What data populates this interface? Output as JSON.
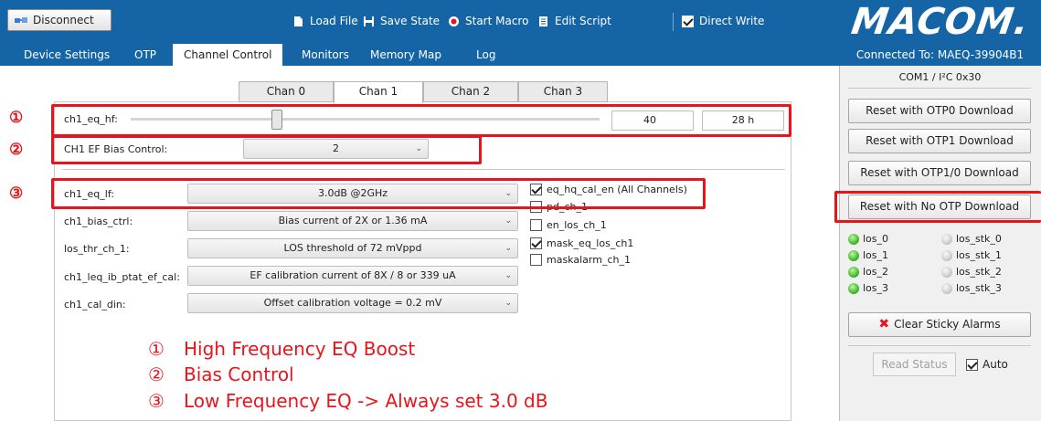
{
  "toolbar": {
    "disconnect_label": "Disconnect",
    "load_file_label": "Load File",
    "save_state_label": "Save State",
    "start_macro_label": "Start Macro",
    "edit_script_label": "Edit Script",
    "direct_write_label": "Direct Write",
    "direct_write_checked": true
  },
  "logo_text": "MACOM.",
  "nav": {
    "tabs": [
      "Device Settings",
      "OTP",
      "Channel Control",
      "Monitors",
      "Memory Map",
      "Log"
    ],
    "active": "Channel Control"
  },
  "connection": {
    "connected_label": "Connected To:  MAEQ-39904B1",
    "port_label": "COM1 / I²C 0x30"
  },
  "channel_tabs": {
    "items": [
      "Chan 0",
      "Chan 1",
      "Chan 2",
      "Chan 3"
    ],
    "active": "Chan 1"
  },
  "hf": {
    "label": "ch1_eq_hf:",
    "value_dec": "40",
    "value_hex": "28 h"
  },
  "bias_control": {
    "label": "CH1 EF Bias Control:",
    "value": "2"
  },
  "params": [
    {
      "label": "ch1_eq_lf:",
      "value": "3.0dB @2GHz"
    },
    {
      "label": "ch1_bias_ctrl:",
      "value": "Bias current of 2X or 1.36 mA"
    },
    {
      "label": "los_thr_ch_1:",
      "value": "LOS threshold of 72 mVppd"
    },
    {
      "label": "ch1_leq_ib_ptat_ef_cal:",
      "value": "EF calibration current of  8X / 8 or 339 uA"
    },
    {
      "label": "ch1_cal_din:",
      "value": "Offset calibration voltage = 0.2 mV"
    }
  ],
  "checkboxes": [
    {
      "label": "eq_hq_cal_en (All Channels)",
      "checked": true
    },
    {
      "label": "pd_ch_1",
      "checked": false
    },
    {
      "label": "en_los_ch_1",
      "checked": false
    },
    {
      "label": "mask_eq_los_ch1",
      "checked": true
    },
    {
      "label": "maskalarm_ch_1",
      "checked": false
    }
  ],
  "right_buttons": {
    "otp0": "Reset with OTP0 Download",
    "otp1": "Reset with OTP1 Download",
    "otp10": "Reset with OTP1/0 Download",
    "no_otp": "Reset with No OTP Download",
    "clear_alarms": "Clear Sticky Alarms",
    "read_status": "Read Status",
    "auto_label": "Auto",
    "auto_checked": true
  },
  "indicators": [
    {
      "label": "los_0",
      "state": "green"
    },
    {
      "label": "los_stk_0",
      "state": "grey"
    },
    {
      "label": "los_1",
      "state": "green"
    },
    {
      "label": "los_stk_1",
      "state": "grey"
    },
    {
      "label": "los_2",
      "state": "green"
    },
    {
      "label": "los_stk_2",
      "state": "grey"
    },
    {
      "label": "los_3",
      "state": "green"
    },
    {
      "label": "los_stk_3",
      "state": "grey"
    }
  ],
  "annotations": {
    "marker_1": "①",
    "marker_2": "②",
    "marker_3": "③",
    "legend": [
      {
        "num": "①",
        "text": "High Frequency EQ Boost"
      },
      {
        "num": "②",
        "text": "Bias Control"
      },
      {
        "num": "③",
        "text": "Low Frequency EQ -> Always set 3.0 dB"
      }
    ]
  },
  "colors": {
    "header_blue": "#1565a6",
    "annotation_red": "#e8141c",
    "led_green": "#3cb52a"
  }
}
